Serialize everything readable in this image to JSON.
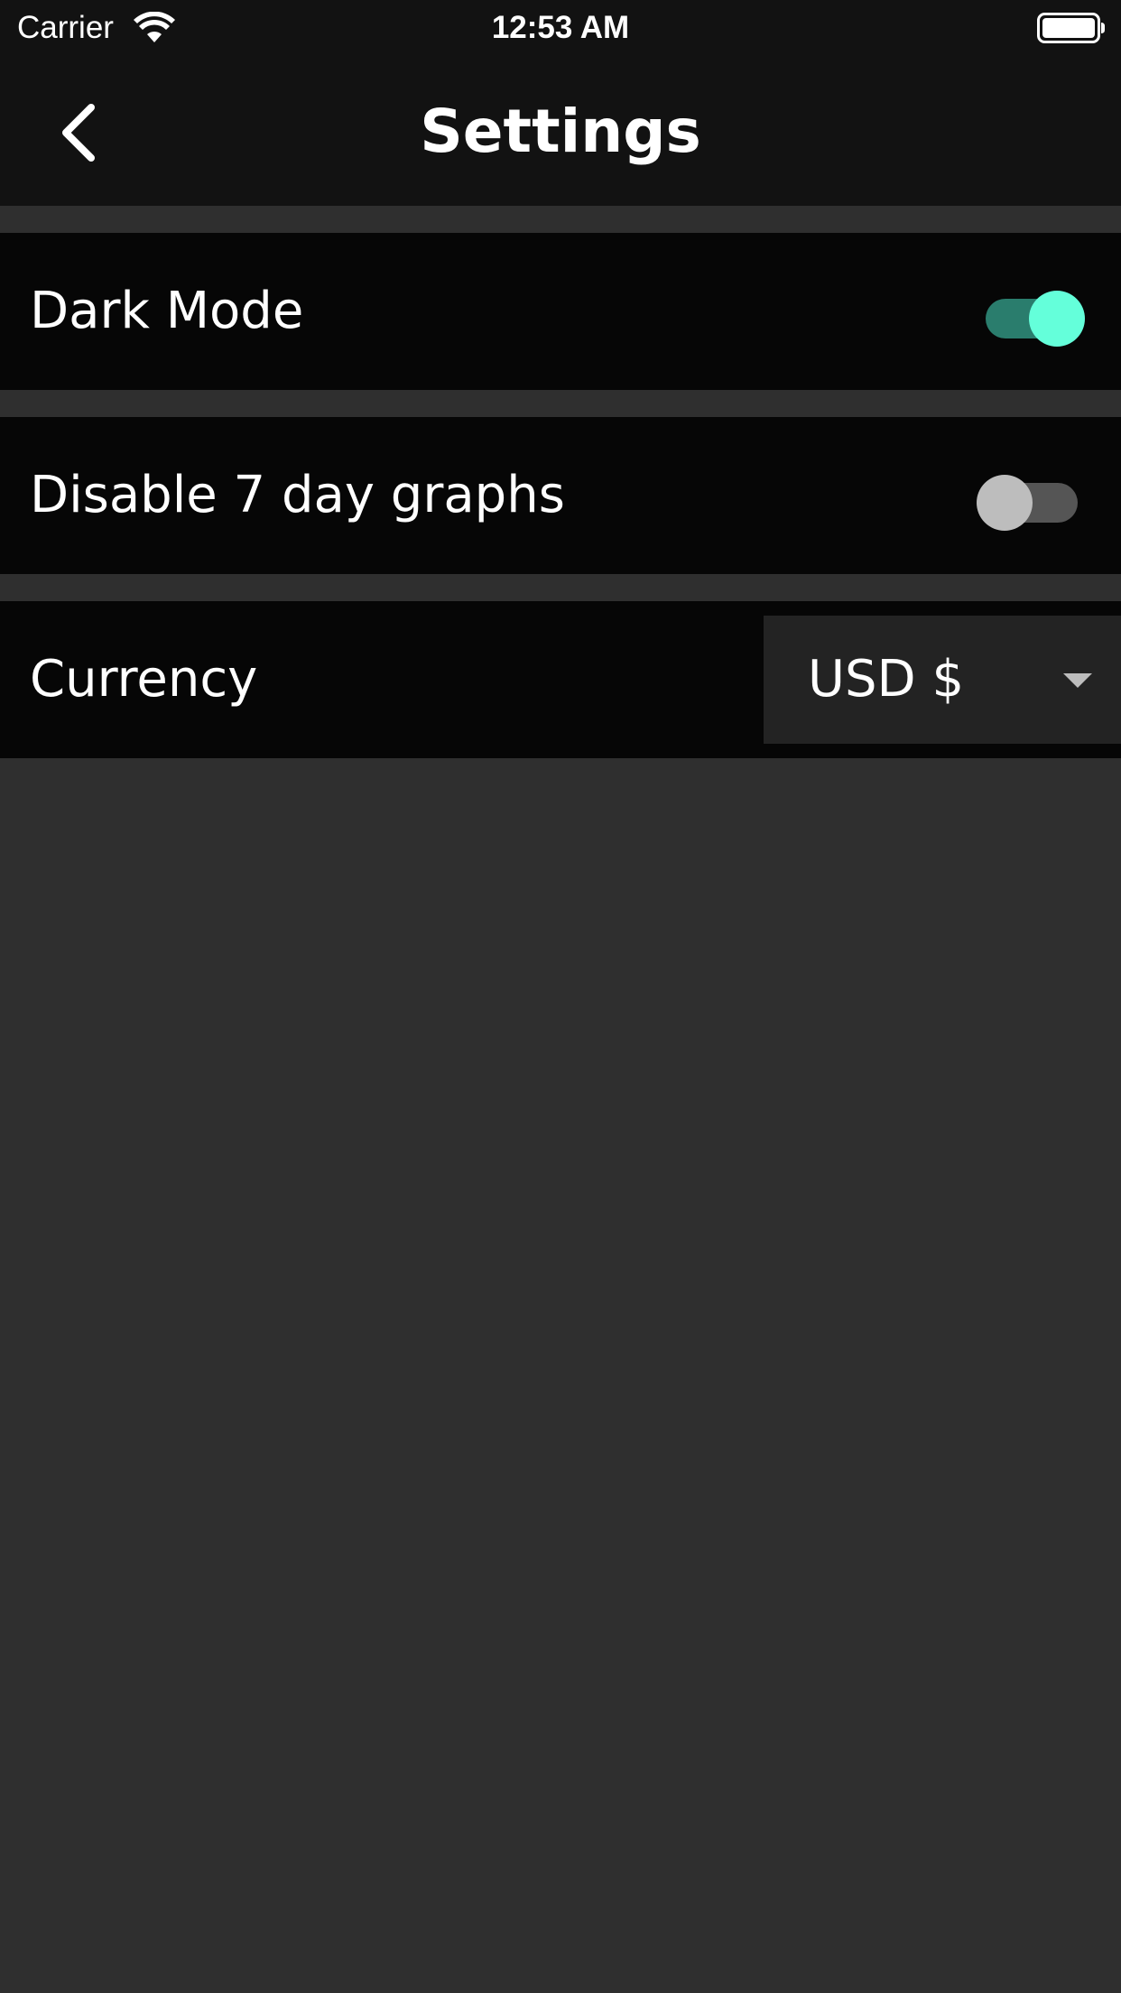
{
  "status_bar": {
    "carrier": "Carrier",
    "time": "12:53 AM",
    "wifi_icon": "wifi-icon",
    "battery_icon": "battery-icon"
  },
  "nav": {
    "title": "Settings",
    "back_icon": "chevron-left-icon"
  },
  "settings": {
    "dark_mode": {
      "label": "Dark Mode",
      "enabled": true
    },
    "disable_graphs": {
      "label": "Disable 7 day graphs",
      "enabled": false
    },
    "currency": {
      "label": "Currency",
      "value": "USD $",
      "caret_icon": "caret-down-icon"
    }
  },
  "colors": {
    "background": "#2f2f2f",
    "header": "#121212",
    "row": "#060606",
    "accent": "#64ffda",
    "accent_track": "#2a7d6d",
    "dropdown": "#232323"
  }
}
